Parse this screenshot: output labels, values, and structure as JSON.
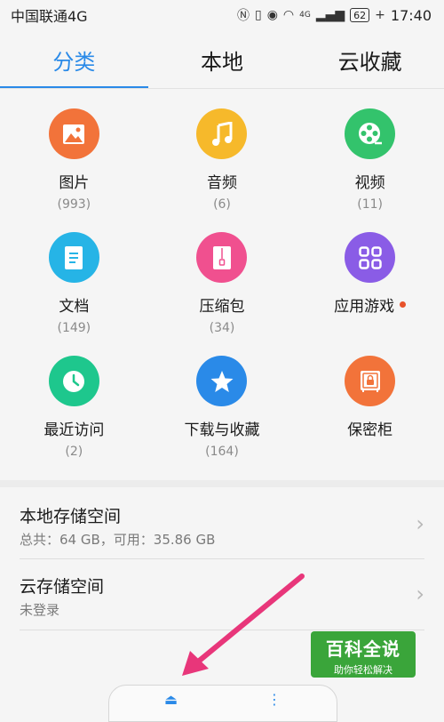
{
  "status_bar": {
    "carrier": "中国联通4G",
    "network_tag": "4G",
    "battery": "62",
    "time": "17:40"
  },
  "tabs": [
    {
      "label": "分类",
      "active": true
    },
    {
      "label": "本地",
      "active": false
    },
    {
      "label": "云收藏",
      "active": false
    }
  ],
  "categories": [
    {
      "label": "图片",
      "count": "(993)",
      "color": "#f2733a",
      "icon": "image-icon"
    },
    {
      "label": "音频",
      "count": "(6)",
      "color": "#f6b92b",
      "icon": "music-icon"
    },
    {
      "label": "视频",
      "count": "(11)",
      "color": "#33c36c",
      "icon": "video-icon"
    },
    {
      "label": "文档",
      "count": "(149)",
      "color": "#26b4e6",
      "icon": "document-icon"
    },
    {
      "label": "压缩包",
      "count": "(34)",
      "color": "#f0508f",
      "icon": "archive-icon"
    },
    {
      "label": "应用游戏",
      "count": "",
      "color": "#8a5ce6",
      "icon": "apps-icon",
      "badge": true
    },
    {
      "label": "最近访问",
      "count": "(2)",
      "color": "#1ec78d",
      "icon": "clock-icon"
    },
    {
      "label": "下载与收藏",
      "count": "(164)",
      "color": "#2a8ae8",
      "icon": "star-icon"
    },
    {
      "label": "保密柜",
      "count": "",
      "color": "#f2733a",
      "icon": "safe-icon"
    }
  ],
  "storage": {
    "local_title": "本地存储空间",
    "local_sub": "总共：64 GB，可用：35.86 GB",
    "cloud_title": "云存储空间",
    "cloud_sub": "未登录"
  },
  "watermark": {
    "title": "百科全说",
    "subtitle": "助你轻松解决"
  },
  "colors": {
    "accent": "#2a8ae8",
    "background": "#f5f5f5",
    "arrow": "#e8367a"
  }
}
